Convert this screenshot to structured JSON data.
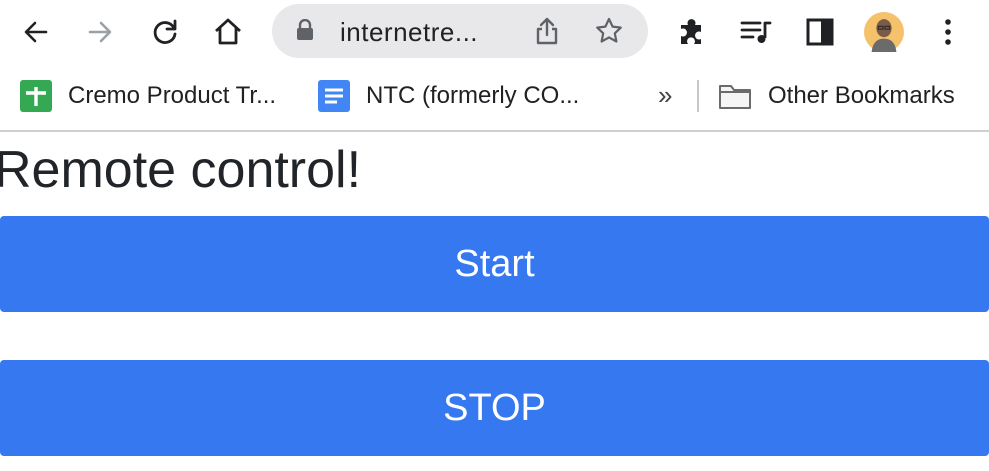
{
  "toolbar": {
    "back_icon": "arrow-left-icon",
    "forward_icon": "arrow-right-icon",
    "reload_icon": "reload-icon",
    "home_icon": "home-icon",
    "omnibox": {
      "url": "internetre..."
    },
    "extensions_icon": "puzzle-icon",
    "media_icon": "media-queue-icon",
    "sidepanel_icon": "side-panel-icon",
    "menu_icon": "kebab-menu-icon"
  },
  "bookmarks": {
    "items": [
      {
        "label": "Cremo Product Tr...",
        "icon": "sheets-icon",
        "color": "#34a853"
      },
      {
        "label": "NTC (formerly CO...",
        "icon": "docs-icon",
        "color": "#4285f4"
      }
    ],
    "overflow": "»",
    "other": {
      "label": "Other Bookmarks",
      "icon": "folder-icon"
    }
  },
  "page": {
    "title": "Remote control!",
    "start_label": "Start",
    "stop_label": "STOP",
    "button_color": "#3578f0"
  }
}
